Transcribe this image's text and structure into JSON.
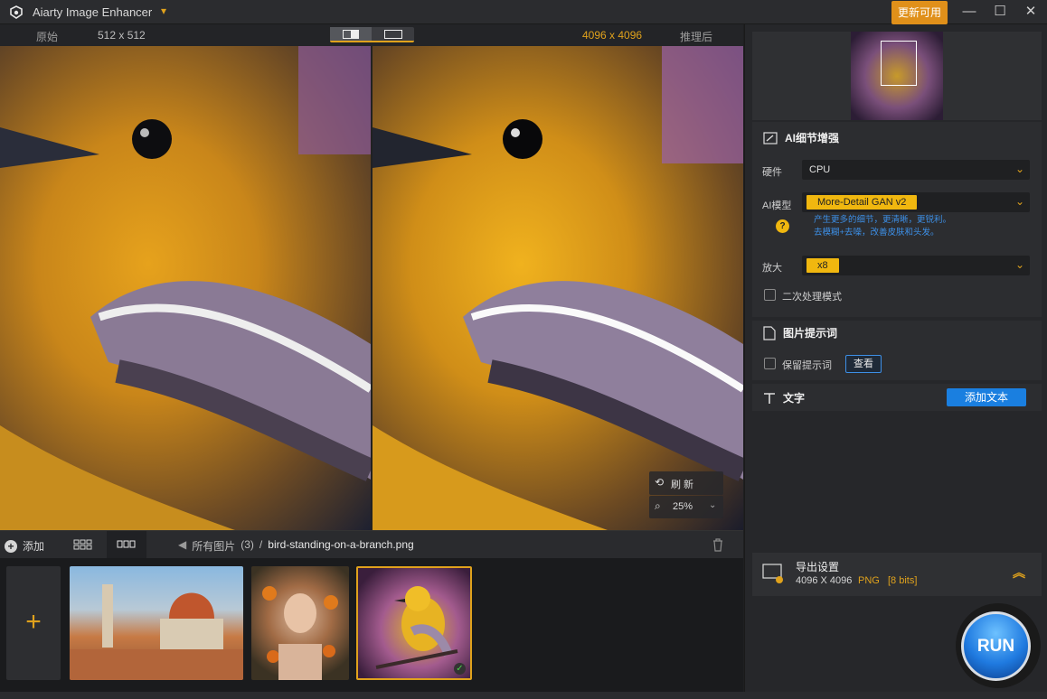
{
  "titlebar": {
    "app_name": "Aiarty Image Enhancer",
    "update_label": "更新可用",
    "minimize": "—",
    "maximize": "☐",
    "close": "✕"
  },
  "compare": {
    "original_label": "原始",
    "original_size": "512 x 512",
    "result_size": "4096 x 4096",
    "result_label": "推理后"
  },
  "overlay": {
    "refresh_label": "刷 新",
    "zoom_value": "25%"
  },
  "filebar": {
    "add_label": "添加",
    "all_images": "所有图片",
    "count": "(3)",
    "separator": "/",
    "filename": "bird-standing-on-a-branch.png"
  },
  "thumbnails": [
    {
      "name": "florence-cathedral",
      "selected": false
    },
    {
      "name": "woman-with-flowers",
      "selected": false
    },
    {
      "name": "bird-standing-on-a-branch",
      "selected": true
    }
  ],
  "panel": {
    "ai_section_title": "AI细节增强",
    "hardware_label": "硬件",
    "hardware_value": "CPU",
    "model_label": "AI模型",
    "model_value": "More-Detail GAN v2",
    "model_desc_line1": "产生更多的细节，更清晰，更锐利。",
    "model_desc_line2": "去模糊+去噪，改善皮肤和头发。",
    "scale_label": "放大",
    "scale_value": "x8",
    "second_pass_label": "二次处理模式",
    "prompt_section_title": "图片提示词",
    "keep_prompt_label": "保留提示词",
    "view_button": "查看",
    "text_section_title": "文字",
    "add_text_button": "添加文本",
    "export_title": "导出设置",
    "export_size": "4096 X 4096",
    "export_format": "PNG",
    "export_bits": "[8 bits]",
    "run_label": "RUN"
  },
  "colors": {
    "accent": "#e0a21c",
    "link_blue": "#3d8fe6",
    "primary_button": "#1a7fe0"
  }
}
